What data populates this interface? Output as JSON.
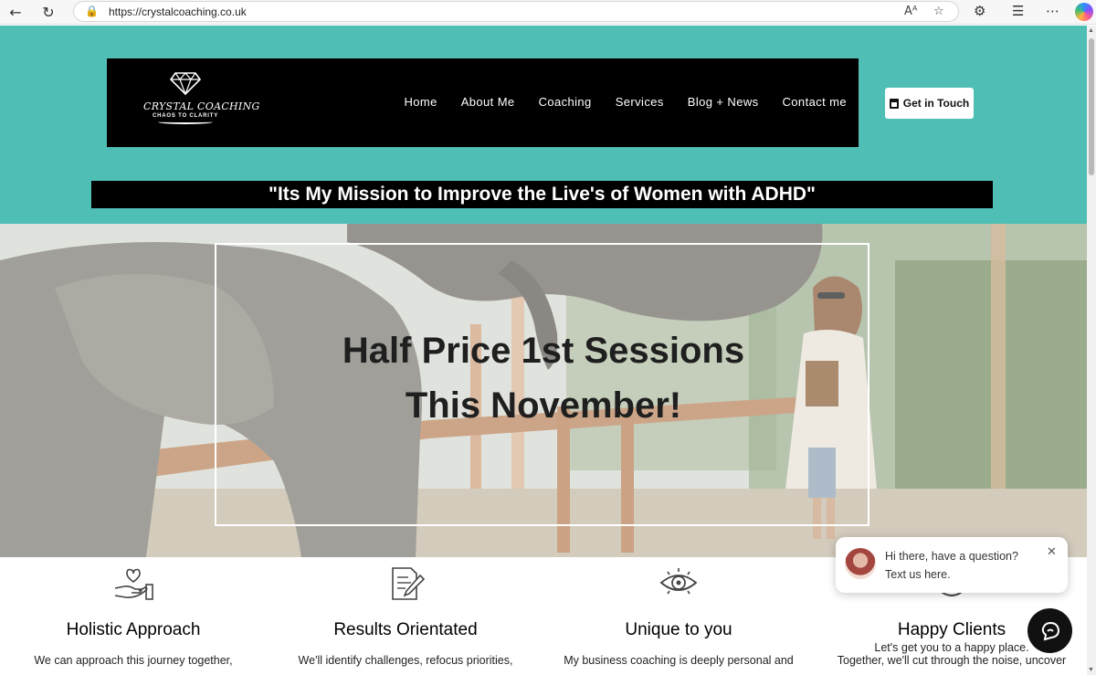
{
  "browser": {
    "url": "https://crystalcoaching.co.uk",
    "back_icon": "back-arrow-icon",
    "reload_icon": "reload-icon",
    "read_aloud_label": "Aᴬ"
  },
  "site": {
    "logo": {
      "title": "CRYSTAL COACHING",
      "subtitle": "CHAOS TO CLARITY"
    },
    "nav": [
      "Home",
      "About Me",
      "Coaching",
      "Services",
      "Blog + News",
      "Contact me"
    ],
    "cta_label": "Get in Touch",
    "mission": "\"Its My Mission to Improve the Live's of Women with ADHD\"",
    "hero": {
      "line1": "Half Price 1st Sessions",
      "line2": "This November!"
    },
    "features": [
      {
        "title": "Holistic Approach",
        "text": "We can approach this journey together,",
        "icon": "heart-hand-icon"
      },
      {
        "title": "Results Orientated",
        "text": "We'll identify challenges, refocus priorities,",
        "icon": "document-pen-icon"
      },
      {
        "title": "Unique to you",
        "text": "My business coaching is deeply personal and",
        "icon": "eye-icon"
      },
      {
        "title": "Happy Clients",
        "text_line1": "Let's get you to a happy place.",
        "text_line2": "Together, we'll cut through the noise, uncover",
        "icon": "smile-icon"
      }
    ]
  },
  "chat": {
    "line1": "Hi there, have a question?",
    "line2": "Text us here."
  },
  "colors": {
    "teal": "#4fbfb5",
    "header_bg": "#000000"
  }
}
